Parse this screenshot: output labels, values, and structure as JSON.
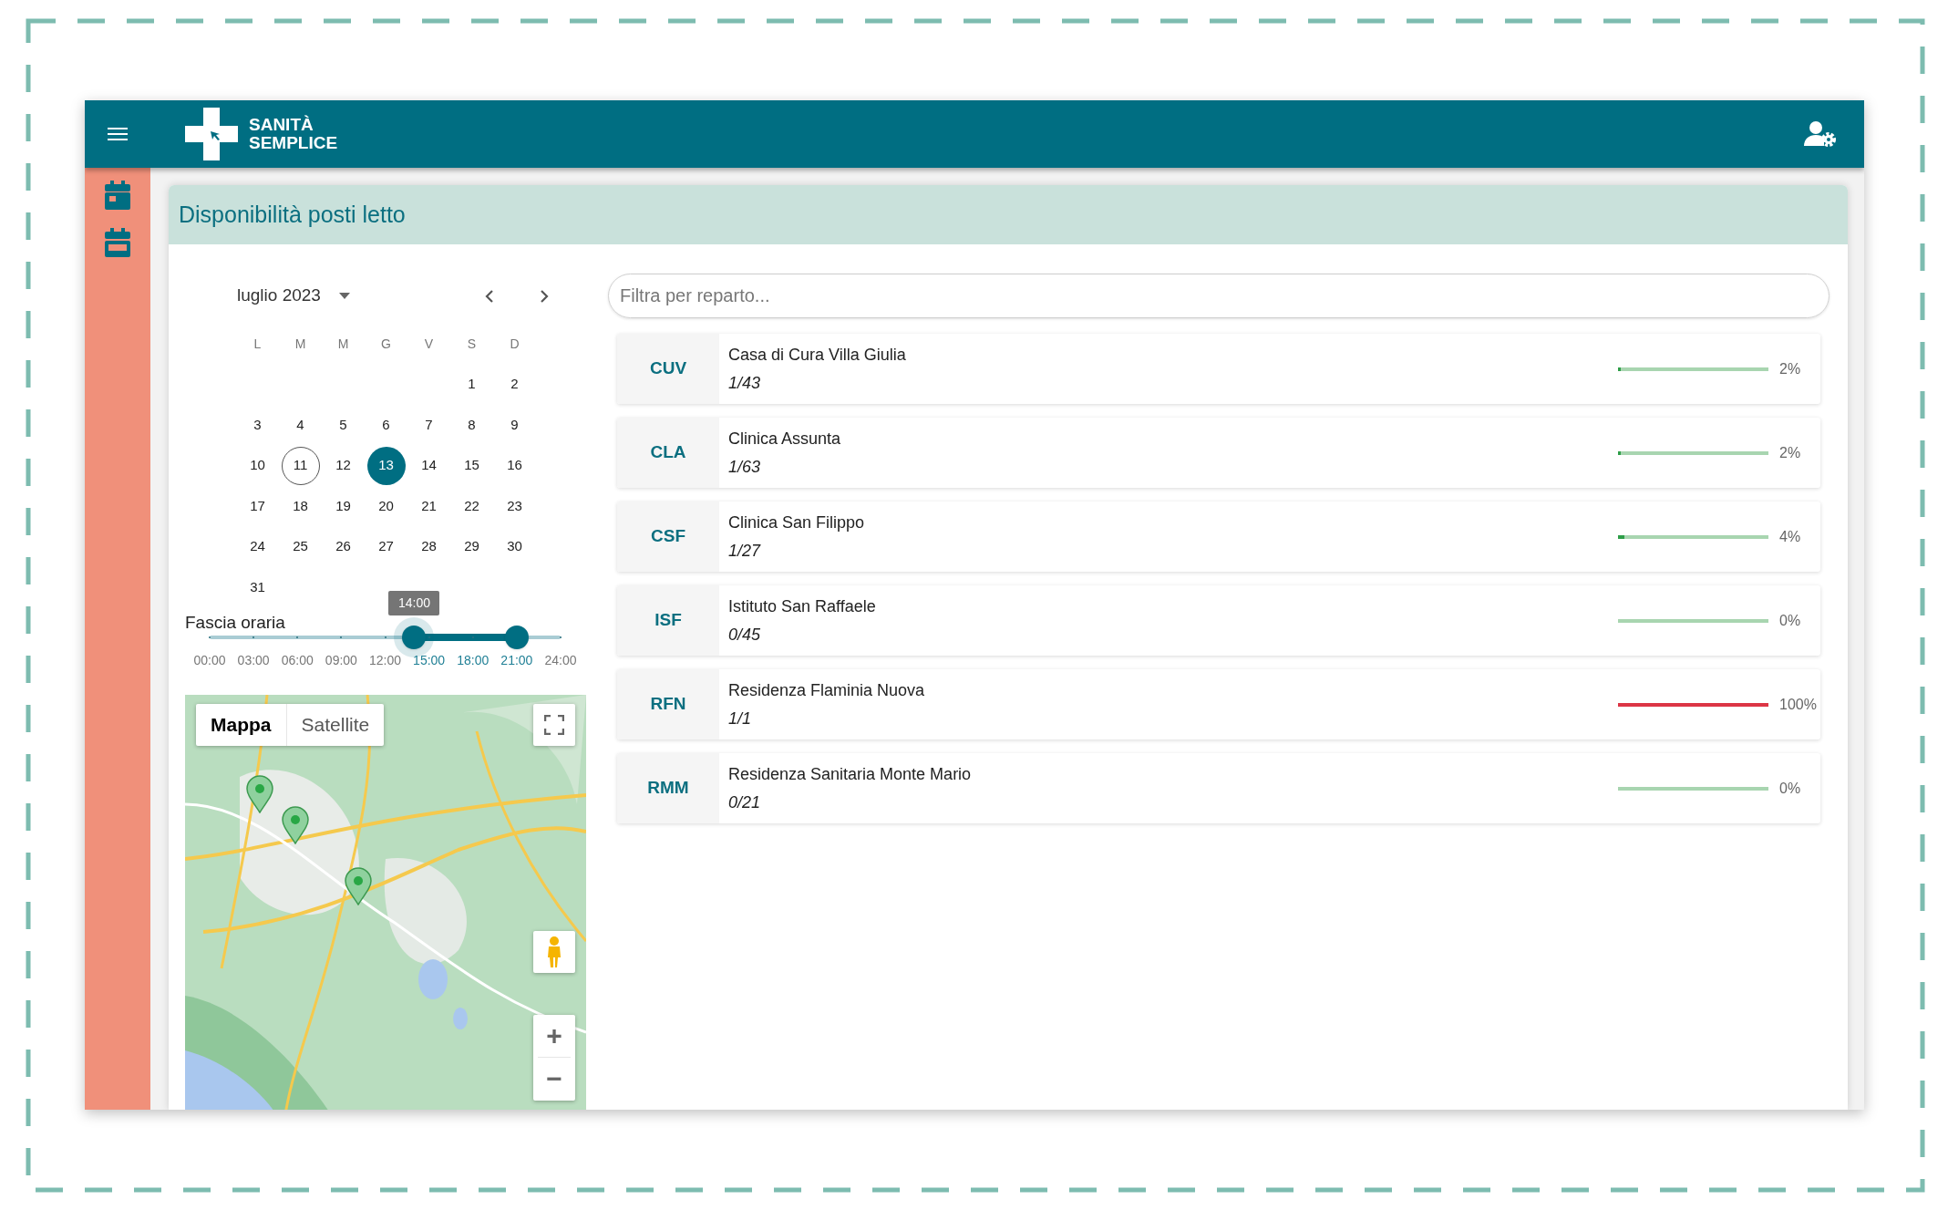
{
  "header": {
    "logo_text": [
      "SANITÀ",
      "SEMPLICE"
    ]
  },
  "page": {
    "title": "Disponibilità posti letto"
  },
  "calendar": {
    "month": "luglio 2023",
    "weekdays": [
      "L",
      "M",
      "M",
      "G",
      "V",
      "S",
      "D"
    ],
    "weeks": [
      [
        {
          "label": "1",
          "selected": false,
          "today": false
        },
        {
          "label": "2",
          "selected": false,
          "today": false
        }
      ],
      [
        {
          "label": "3",
          "selected": false,
          "today": false
        },
        {
          "label": "4",
          "selected": false,
          "today": false
        },
        {
          "label": "5",
          "selected": false,
          "today": false
        },
        {
          "label": "6",
          "selected": false,
          "today": false
        },
        {
          "label": "7",
          "selected": false,
          "today": false
        },
        {
          "label": "8",
          "selected": false,
          "today": false
        },
        {
          "label": "9",
          "selected": false,
          "today": false
        }
      ],
      [
        {
          "label": "10",
          "selected": false,
          "today": false
        },
        {
          "label": "11",
          "selected": false,
          "today": true
        },
        {
          "label": "12",
          "selected": false,
          "today": false
        },
        {
          "label": "13",
          "selected": true,
          "today": false
        },
        {
          "label": "14",
          "selected": false,
          "today": false
        },
        {
          "label": "15",
          "selected": false,
          "today": false
        },
        {
          "label": "16",
          "selected": false,
          "today": false
        }
      ],
      [
        {
          "label": "17",
          "selected": false,
          "today": false
        },
        {
          "label": "18",
          "selected": false,
          "today": false
        },
        {
          "label": "19",
          "selected": false,
          "today": false
        },
        {
          "label": "20",
          "selected": false,
          "today": false
        },
        {
          "label": "21",
          "selected": false,
          "today": false
        },
        {
          "label": "22",
          "selected": false,
          "today": false
        },
        {
          "label": "23",
          "selected": false,
          "today": false
        }
      ],
      [
        {
          "label": "24",
          "selected": false,
          "today": false
        },
        {
          "label": "25",
          "selected": false,
          "today": false
        },
        {
          "label": "26",
          "selected": false,
          "today": false
        },
        {
          "label": "27",
          "selected": false,
          "today": false
        },
        {
          "label": "28",
          "selected": false,
          "today": false
        },
        {
          "label": "29",
          "selected": false,
          "today": false
        },
        {
          "label": "30",
          "selected": false,
          "today": false
        }
      ],
      [
        {
          "label": "31",
          "selected": false,
          "today": false
        }
      ]
    ]
  },
  "time_range": {
    "label": "Fascia oraria",
    "tooltip": "14:00",
    "start": {
      "level": 0.583
    },
    "end": {
      "level": 0.875
    },
    "ticks": [
      {
        "label": "00:00",
        "in_range": false
      },
      {
        "label": "03:00",
        "in_range": false
      },
      {
        "label": "06:00",
        "in_range": false
      },
      {
        "label": "09:00",
        "in_range": false
      },
      {
        "label": "12:00",
        "in_range": false
      },
      {
        "label": "15:00",
        "in_range": true
      },
      {
        "label": "18:00",
        "in_range": true
      },
      {
        "label": "21:00",
        "in_range": true
      },
      {
        "label": "24:00",
        "in_range": false
      }
    ]
  },
  "map": {
    "kind": "picture",
    "map_types": [
      {
        "label": "Mappa",
        "selected": true
      },
      {
        "label": "Satellite",
        "selected": false
      }
    ],
    "zoom_in": "+",
    "zoom_out": "−"
  },
  "filter": {
    "placeholder": "Filtra per reparto..."
  },
  "facilities": [
    {
      "code": "CUV",
      "name": "Casa di Cura Villa Giulia",
      "occupancy": "1/43",
      "level": 0.02,
      "percent": "2%",
      "color": "#2e9e48"
    },
    {
      "code": "CLA",
      "name": "Clinica Assunta",
      "occupancy": "1/63",
      "level": 0.02,
      "percent": "2%",
      "color": "#2e9e48"
    },
    {
      "code": "CSF",
      "name": "Clinica San Filippo",
      "occupancy": "1/27",
      "level": 0.04,
      "percent": "4%",
      "color": "#2e9e48"
    },
    {
      "code": "ISF",
      "name": "Istituto San Raffaele",
      "occupancy": "0/45",
      "level": 0,
      "percent": "0%"
    },
    {
      "code": "RFN",
      "name": "Residenza Flaminia Nuova",
      "occupancy": "1/1",
      "level": 1,
      "percent": "100%",
      "color": "#dc3545"
    },
    {
      "code": "RMM",
      "name": "Residenza Sanitaria Monte Mario",
      "occupancy": "0/21",
      "level": 0,
      "percent": "0%"
    }
  ]
}
